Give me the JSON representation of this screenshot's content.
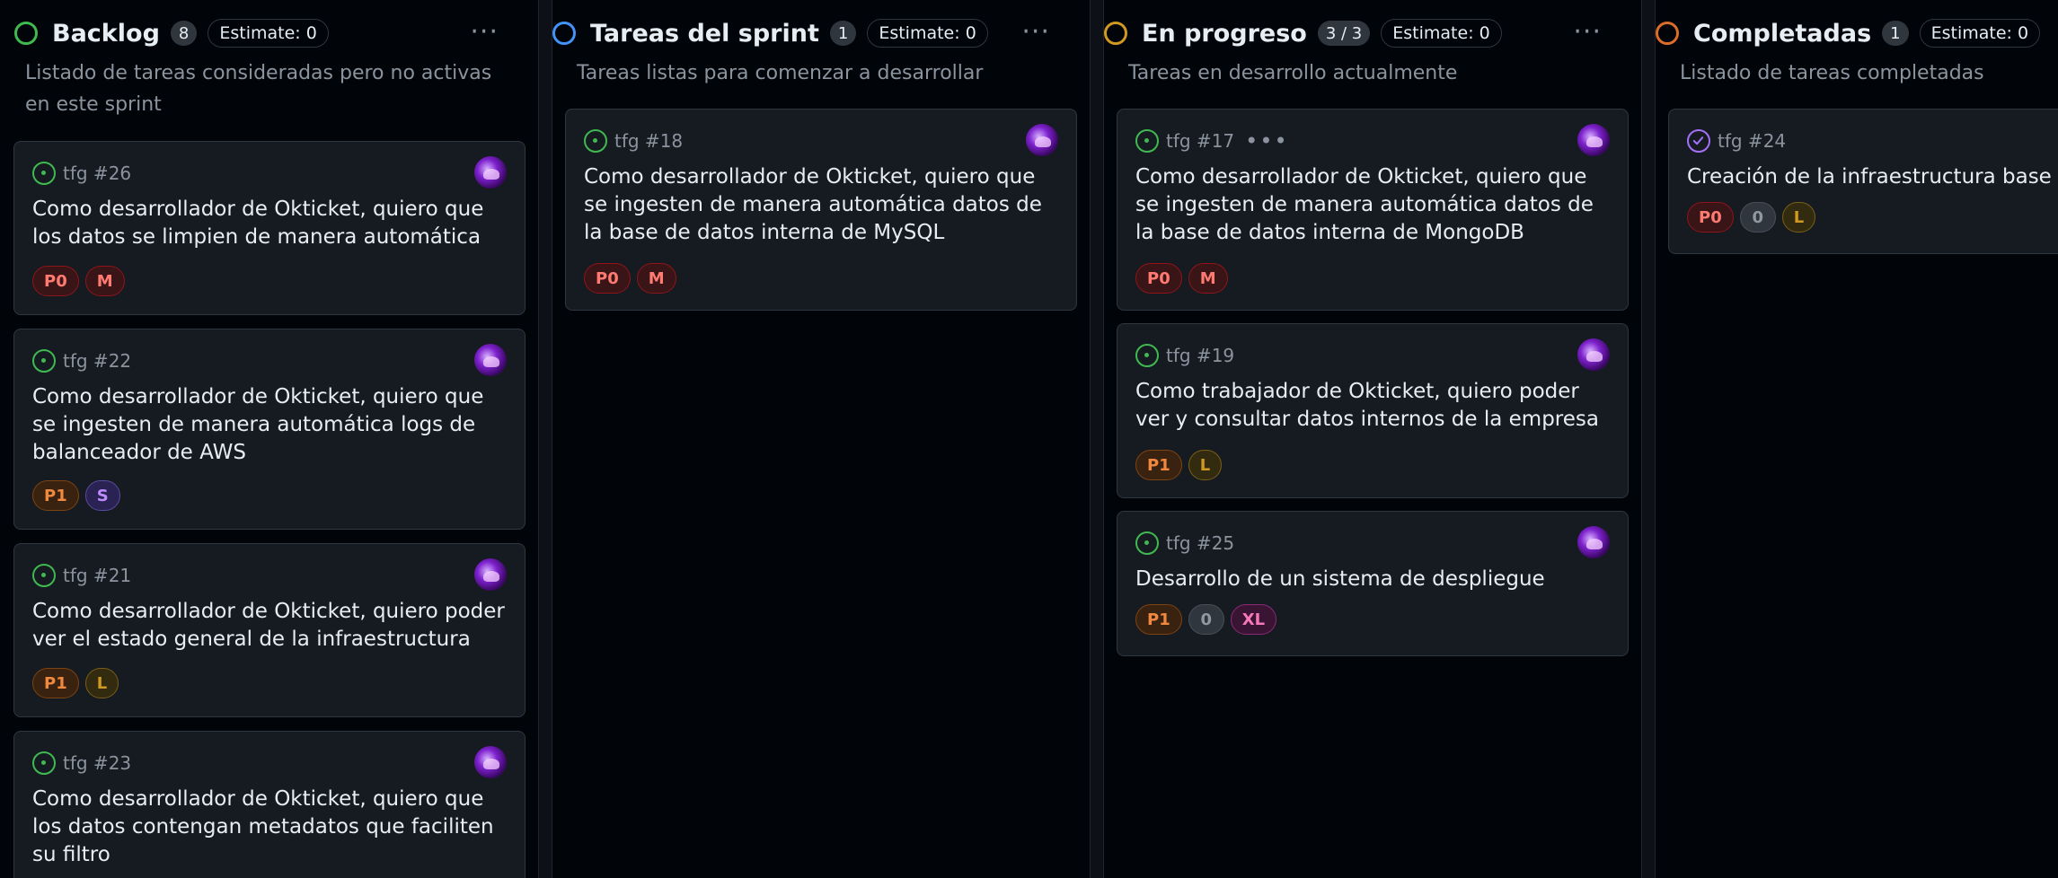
{
  "columns": [
    {
      "title": "Backlog",
      "count": "8",
      "estimate": "Estimate: 0",
      "status_color": "#3fb950",
      "description": "Listado de tareas consideradas pero no activas en este sprint",
      "menu": "···",
      "cards": [
        {
          "ref": "tfg #26",
          "title": "Como desarrollador de Okticket, quiero que los datos se limpien de manera automática",
          "labels": [
            "P0",
            "M"
          ]
        },
        {
          "ref": "tfg #22",
          "title": "Como desarrollador de Okticket, quiero que se ingesten de manera automática logs de balanceador de AWS",
          "labels": [
            "P1",
            "S"
          ]
        },
        {
          "ref": "tfg #21",
          "title": "Como desarrollador de Okticket, quiero poder ver el estado general de la infraestructura",
          "labels": [
            "P1",
            "L"
          ]
        },
        {
          "ref": "tfg #23",
          "title": "Como desarrollador de Okticket, quiero que los datos contengan metadatos que faciliten su filtro",
          "labels": []
        }
      ]
    },
    {
      "title": "Tareas del sprint",
      "count": "1",
      "estimate": "Estimate: 0",
      "status_color": "#4493f8",
      "description": "Tareas listas para comenzar a desarrollar",
      "menu": "···",
      "cards": [
        {
          "ref": "tfg #18",
          "title": "Como desarrollador de Okticket, quiero que se ingesten de manera automática datos de la base de datos interna de MySQL",
          "labels": [
            "P0",
            "M"
          ]
        }
      ]
    },
    {
      "title": "En progreso",
      "count": "3 / 3",
      "estimate": "Estimate: 0",
      "status_color": "#d29922",
      "description": "Tareas en desarrollo actualmente",
      "menu": "···",
      "cards": [
        {
          "ref": "tfg #17",
          "dots": "•••",
          "title": "Como desarrollador de Okticket, quiero que se ingesten de manera automática datos de la base de datos interna de MongoDB",
          "labels": [
            "P0",
            "M"
          ]
        },
        {
          "ref": "tfg #19",
          "title": "Como trabajador de Okticket, quiero poder ver y consultar datos internos de la empresa",
          "labels": [
            "P1",
            "L"
          ]
        },
        {
          "ref": "tfg #25",
          "title": "Desarrollo de un sistema de despliegue",
          "labels": [
            "P1",
            "0",
            "XL"
          ]
        }
      ]
    },
    {
      "title": "Completadas",
      "count": "1",
      "estimate": "Estimate: 0",
      "status_color": "#db6d28",
      "description": "Listado de tareas completadas",
      "cards": [
        {
          "ref": "tfg #24",
          "title": "Creación de la infraestructura base",
          "labels": [
            "P0",
            "0",
            "L"
          ]
        }
      ]
    }
  ]
}
